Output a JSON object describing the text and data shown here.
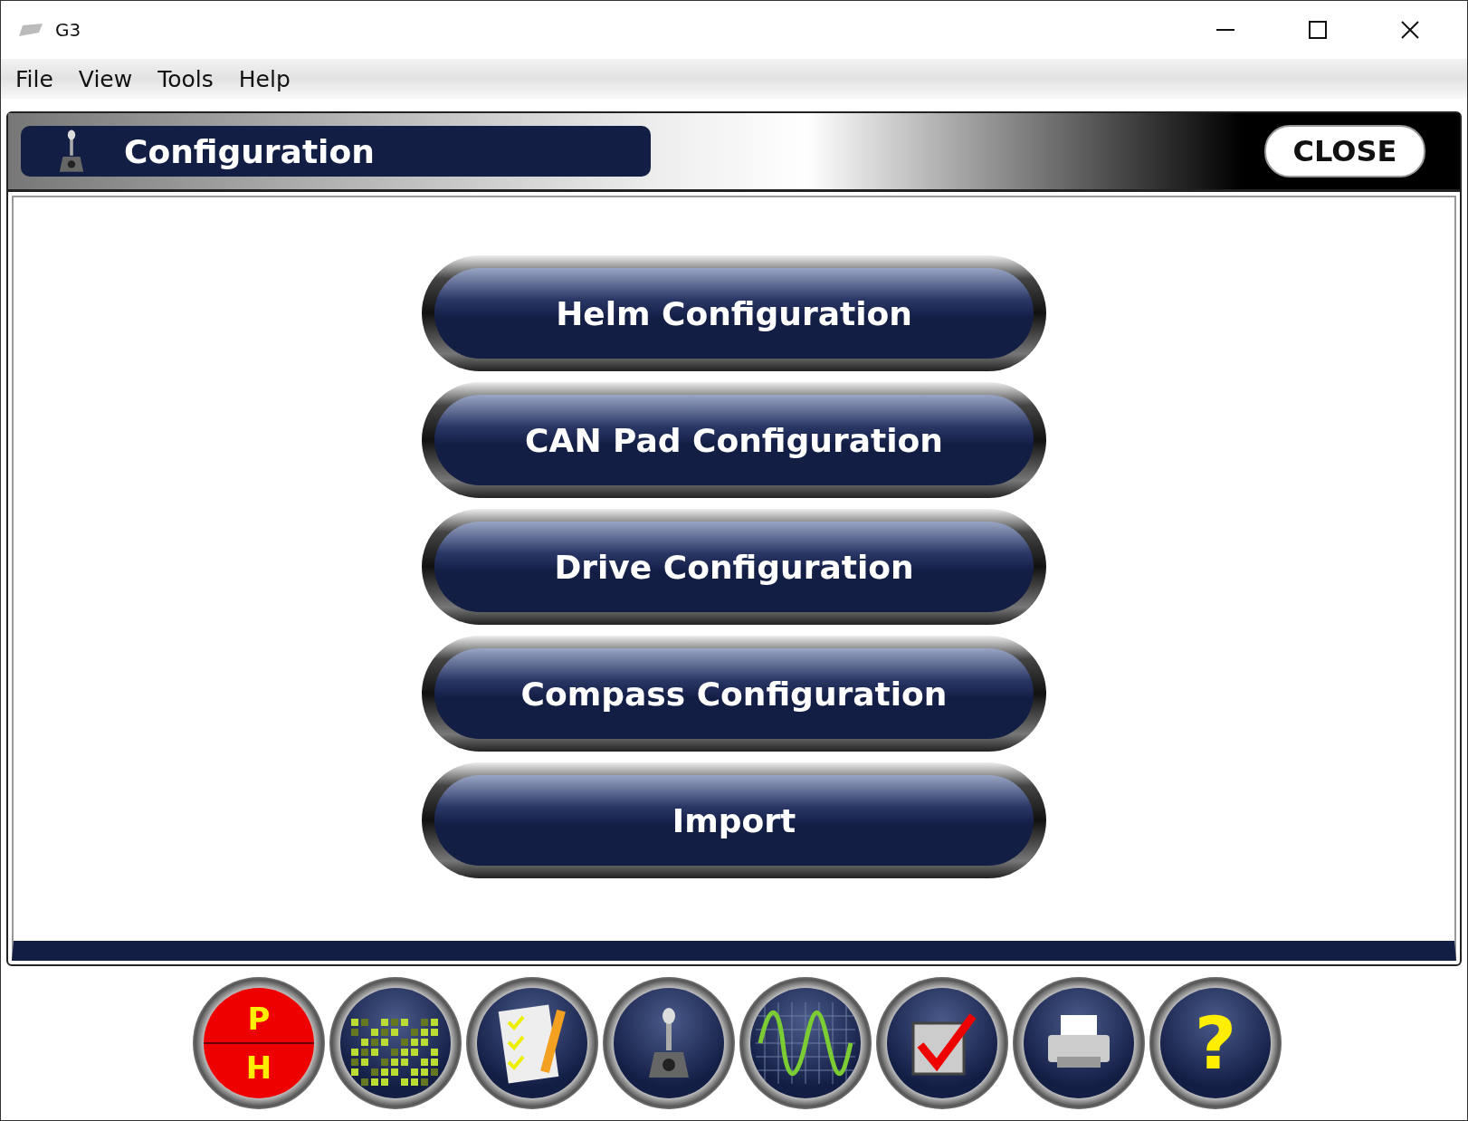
{
  "window": {
    "title": "G3"
  },
  "menu": [
    "File",
    "View",
    "Tools",
    "Help"
  ],
  "header": {
    "title": "Configuration",
    "close_label": "CLOSE"
  },
  "buttons": [
    "Helm Configuration",
    "CAN Pad Configuration",
    "Drive Configuration",
    "Compass Configuration",
    "Import"
  ],
  "toolbar": [
    {
      "kind": "ph",
      "top": "P",
      "bottom": "H"
    },
    {
      "kind": "matrix"
    },
    {
      "kind": "checklist"
    },
    {
      "kind": "joystick"
    },
    {
      "kind": "wave"
    },
    {
      "kind": "check"
    },
    {
      "kind": "printer"
    },
    {
      "kind": "help",
      "symbol": "?"
    }
  ]
}
